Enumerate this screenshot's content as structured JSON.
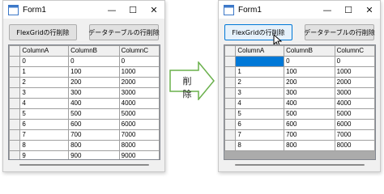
{
  "left_window": {
    "title": "Form1",
    "controls": {
      "minimize": "—",
      "maximize": "☐",
      "close": "✕"
    },
    "button1": "FlexGridの行削除",
    "button2": "データテーブルの行削除",
    "columns": [
      "ColumnA",
      "ColumnB",
      "ColumnC"
    ],
    "rows": [
      [
        "0",
        "0",
        "0"
      ],
      [
        "1",
        "100",
        "1000"
      ],
      [
        "2",
        "200",
        "2000"
      ],
      [
        "3",
        "300",
        "3000"
      ],
      [
        "4",
        "400",
        "4000"
      ],
      [
        "5",
        "500",
        "5000"
      ],
      [
        "6",
        "600",
        "6000"
      ],
      [
        "7",
        "700",
        "7000"
      ],
      [
        "8",
        "800",
        "8000"
      ],
      [
        "9",
        "900",
        "9000"
      ]
    ]
  },
  "arrow": {
    "label": "削 除",
    "color": "#6ab04c"
  },
  "right_window": {
    "title": "Form1",
    "controls": {
      "minimize": "—",
      "maximize": "☐",
      "close": "✕"
    },
    "button1": "FlexGridの行削除",
    "button2": "データテーブルの行削除",
    "columns": [
      "ColumnA",
      "ColumnB",
      "ColumnC"
    ],
    "rows": [
      [
        "",
        "0",
        "0"
      ],
      [
        "1",
        "100",
        "1000"
      ],
      [
        "2",
        "200",
        "2000"
      ],
      [
        "3",
        "300",
        "3000"
      ],
      [
        "4",
        "400",
        "4000"
      ],
      [
        "5",
        "500",
        "5000"
      ],
      [
        "6",
        "600",
        "6000"
      ],
      [
        "7",
        "700",
        "7000"
      ],
      [
        "8",
        "800",
        "8000"
      ]
    ],
    "selected_cell": {
      "row": 0,
      "column": 0
    }
  },
  "colors": {
    "selection": "#0078d7",
    "button_focus_border": "#0078d7"
  }
}
